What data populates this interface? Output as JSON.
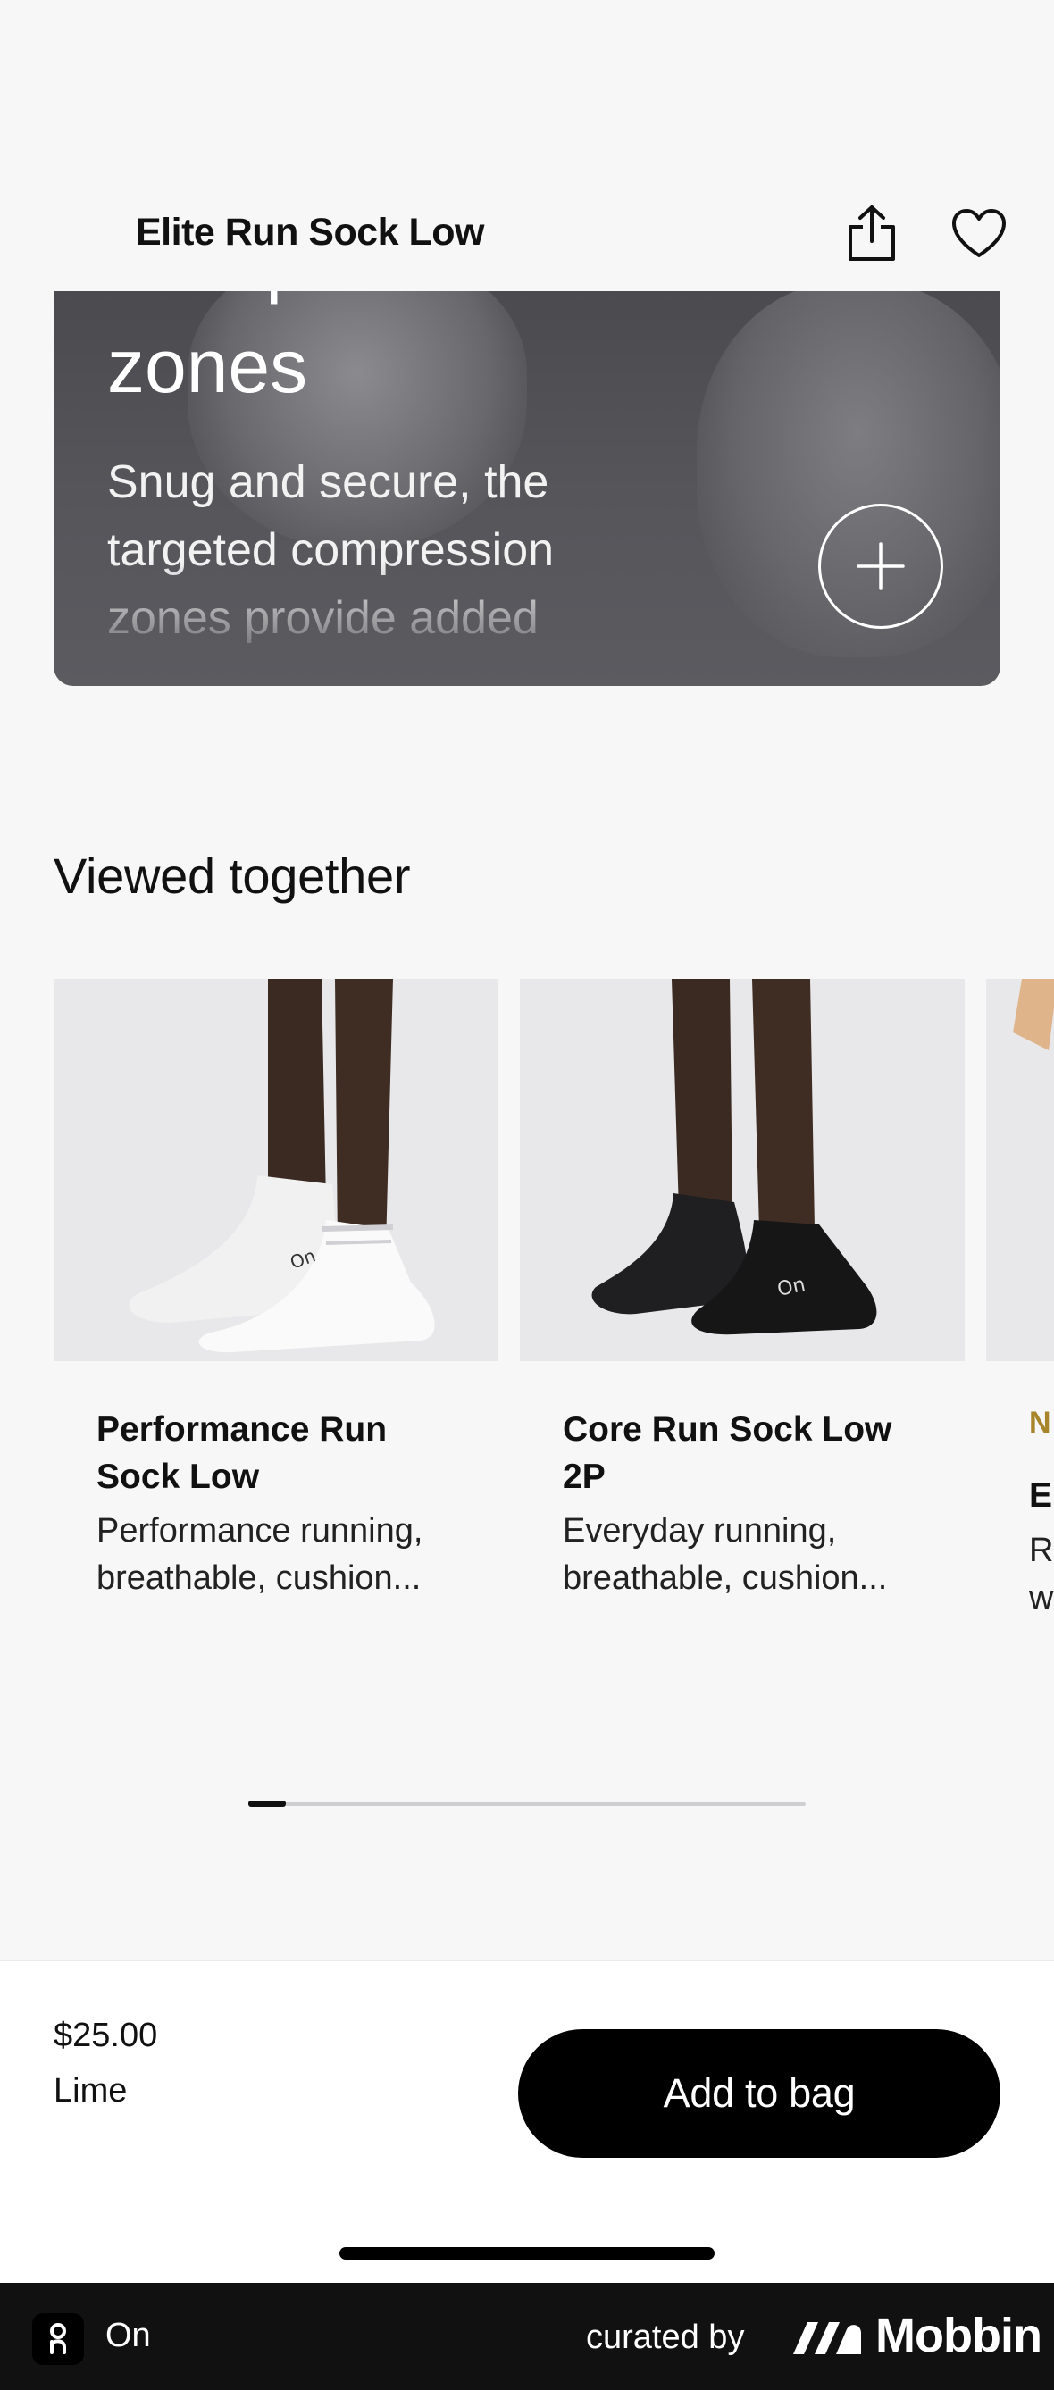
{
  "header": {
    "title": "Elite Run Sock Low",
    "close_icon": "close-icon",
    "share_icon": "share-icon",
    "favorite_icon": "heart-icon"
  },
  "feature": {
    "heading_cut": "Compression",
    "heading": "zones",
    "text": "Snug and secure, the targeted compression zones provide added",
    "expand_icon": "plus-icon"
  },
  "viewed_together": {
    "title": "Viewed together",
    "products": [
      {
        "name": "Performance Run Sock Low",
        "description": "Performance running, breathable, cushion...",
        "sock_color": "#f2f2f2"
      },
      {
        "name": "Core Run Sock Low 2P",
        "description": "Everyday running, breathable, cushion...",
        "sock_color": "#1c1c1e"
      },
      {
        "badge": "N",
        "name": "E",
        "description": "R w"
      }
    ]
  },
  "bottom_bar": {
    "price": "$25.00",
    "color": "Lime",
    "add_to_bag": "Add to bag"
  },
  "footer": {
    "app_name": "On",
    "curated_by": "curated by",
    "brand": "Mobbin"
  },
  "colors": {
    "accent": "#000000",
    "badge": "#a8842a",
    "footer_bg": "#111111"
  }
}
